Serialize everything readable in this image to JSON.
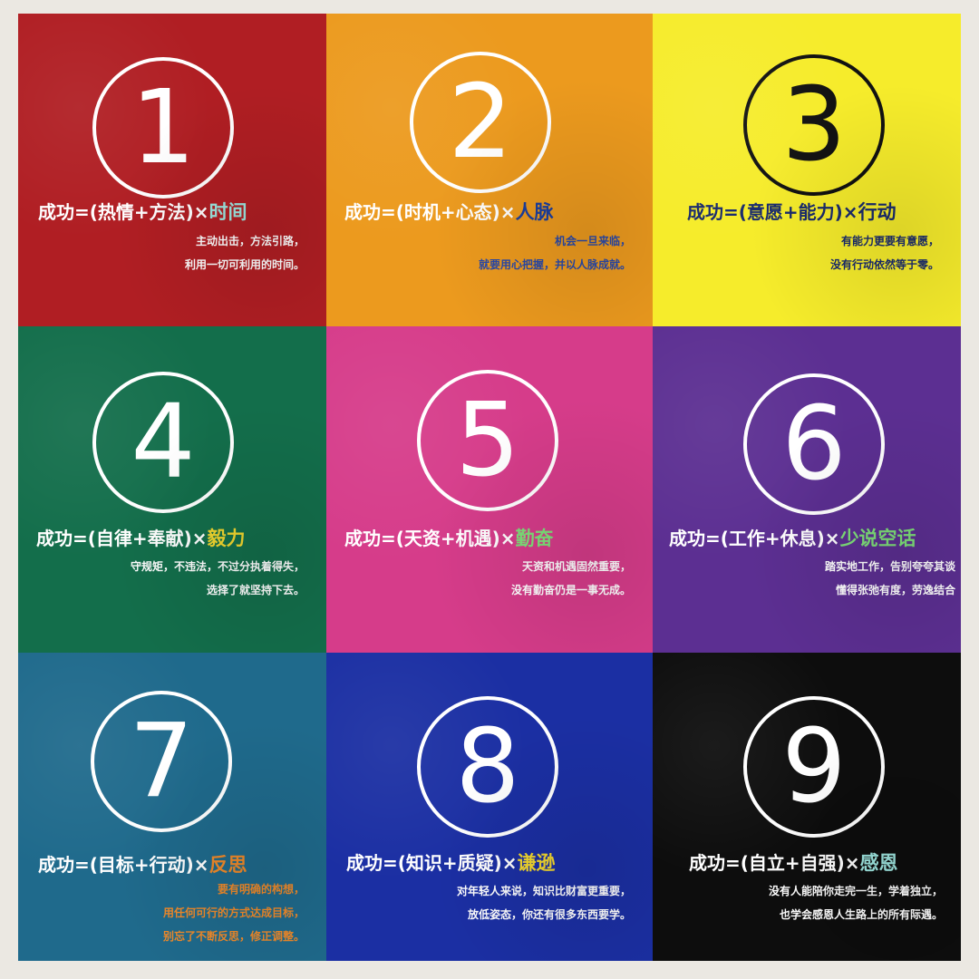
{
  "colors": {
    "background": "#ebe8e2",
    "tile1": "#b01e23",
    "tile2": "#ec9a1e",
    "tile3": "#f6ec2b",
    "tile4": "#136e4b",
    "tile5": "#d63c8a",
    "tile6": "#5c2f92",
    "tile7": "#1f6a8c",
    "tile8": "#1b2fa3",
    "tile9": "#0d0d0d"
  },
  "tiles": [
    {
      "number": "1",
      "formula_prefix": "成功=(热情+方法)×",
      "keyword": "时间",
      "keyword_color": "#9ee6e0",
      "lines": [
        "主动出击，方法引路，",
        "利用一切可利用的时间。"
      ],
      "text_color": "#ffffff",
      "circle_color": "#ffffff"
    },
    {
      "number": "2",
      "formula_prefix": "成功=(时机+心态)×",
      "keyword": "人脉",
      "keyword_color": "#1c3f9e",
      "lines": [
        "机会一旦来临，",
        "就要用心把握，并以人脉成就。"
      ],
      "text_color": "#ffffff",
      "desc_color": "#2a49a8",
      "circle_color": "#ffffff"
    },
    {
      "number": "3",
      "formula_prefix": "成功=(意愿+能力)×",
      "keyword": "行动",
      "keyword_color": "#1a2b6d",
      "lines": [
        "有能力更要有意愿，",
        "没有行动依然等于零。"
      ],
      "text_color": "#1a2b6d",
      "circle_color": "#111111"
    },
    {
      "number": "4",
      "formula_prefix": "成功=(自律+奉献)×",
      "keyword": "毅力",
      "keyword_color": "#f2d72f",
      "lines": [
        "守规矩，不违法，不过分执着得失，",
        "选择了就坚持下去。"
      ],
      "text_color": "#ffffff",
      "circle_color": "#ffffff"
    },
    {
      "number": "5",
      "formula_prefix": "成功=(天资+机遇)×",
      "keyword": "勤奋",
      "keyword_color": "#7fe07a",
      "lines": [
        "天资和机遇固然重要，",
        "没有勤奋仍是一事无成。"
      ],
      "text_color": "#ffffff",
      "circle_color": "#ffffff"
    },
    {
      "number": "6",
      "formula_prefix": "成功=(工作+休息)×",
      "keyword": "少说空话",
      "keyword_color": "#7fe07a",
      "lines": [
        "踏实地工作，告别夸夸其谈",
        "懂得张弛有度，劳逸结合"
      ],
      "text_color": "#ffffff",
      "circle_color": "#ffffff"
    },
    {
      "number": "7",
      "formula_prefix": "成功=(目标+行动)×",
      "keyword": "反思",
      "keyword_color": "#f08a2a",
      "lines": [
        "要有明确的构想，",
        "用任何可行的方式达成目标，",
        "别忘了不断反思，修正调整。"
      ],
      "text_color": "#ffffff",
      "desc_color": "#f08a2a",
      "circle_color": "#ffffff"
    },
    {
      "number": "8",
      "formula_prefix": "成功=(知识+质疑)×",
      "keyword": "谦逊",
      "keyword_color": "#f2d72f",
      "lines": [
        "对年轻人来说，知识比财富更重要，",
        "放低姿态，你还有很多东西要学。"
      ],
      "text_color": "#ffffff",
      "circle_color": "#ffffff"
    },
    {
      "number": "9",
      "formula_prefix": "成功=(自立+自强)×",
      "keyword": "感恩",
      "keyword_color": "#9ee6e0",
      "lines": [
        "没有人能陪你走完一生，学着独立，",
        "也学会感恩人生路上的所有际遇。"
      ],
      "text_color": "#ffffff",
      "circle_color": "#ffffff"
    }
  ]
}
